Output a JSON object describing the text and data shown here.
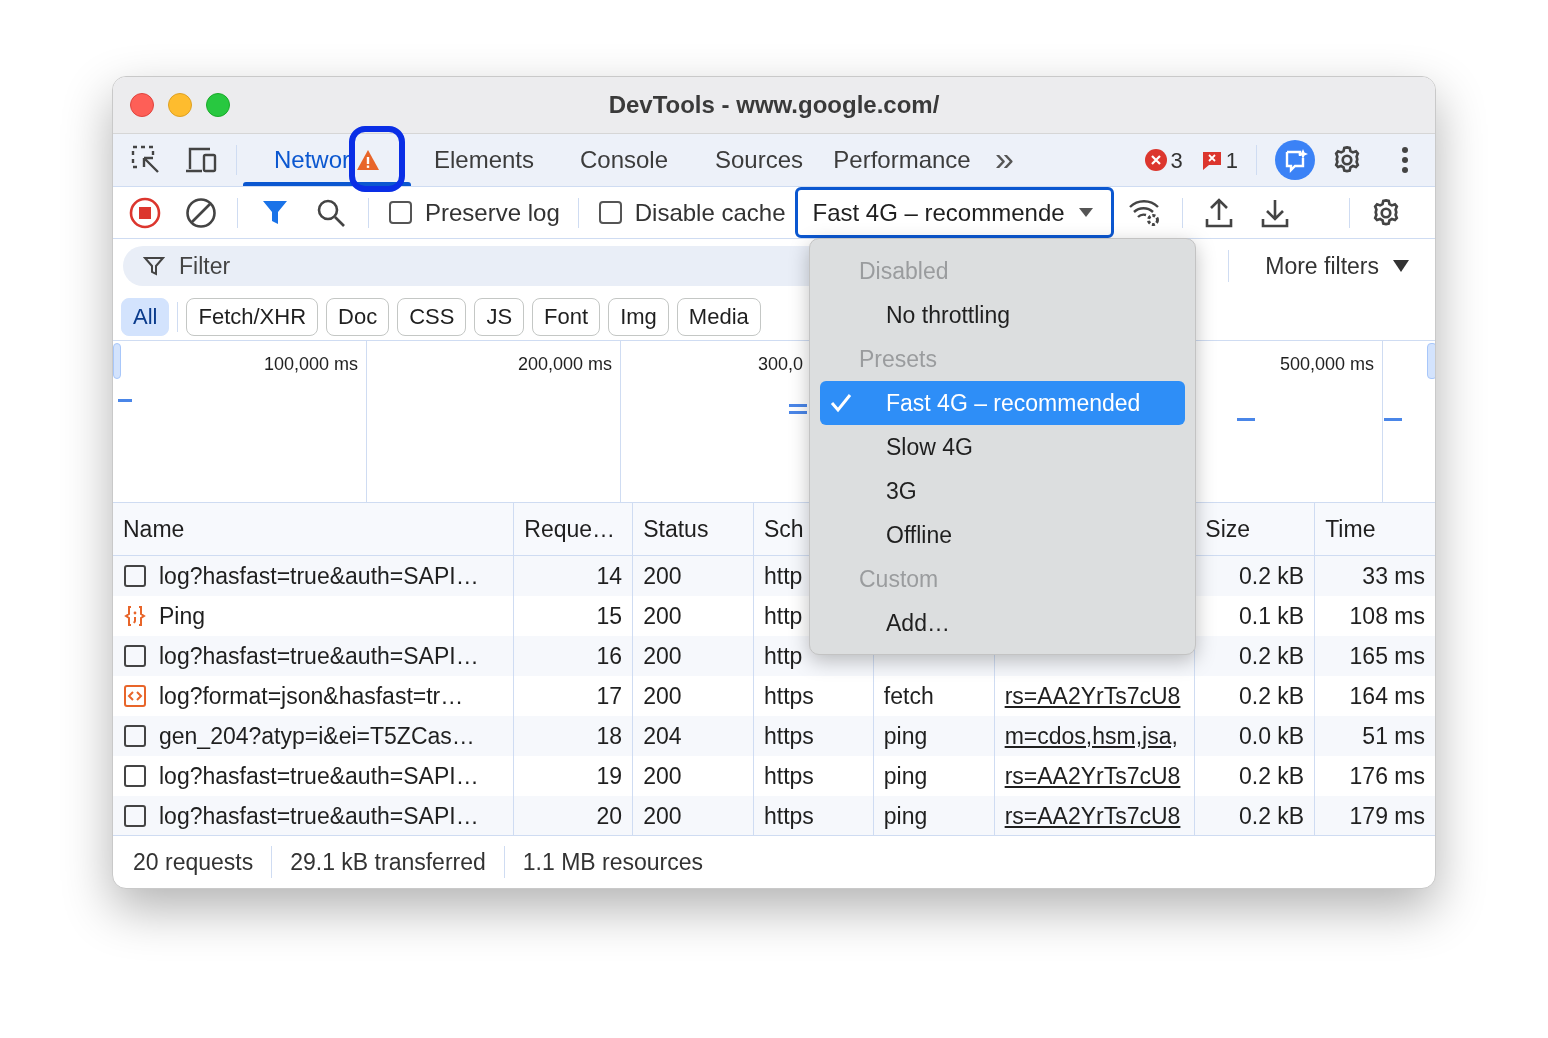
{
  "window": {
    "title": "DevTools - www.google.com/"
  },
  "tabs": [
    {
      "label": "Networ",
      "selected": true,
      "warning": true
    },
    {
      "label": "Elements",
      "selected": false
    },
    {
      "label": "Console",
      "selected": false
    },
    {
      "label": "Sources",
      "selected": false
    },
    {
      "label": "Performance",
      "selected": false
    }
  ],
  "overflow_glyph": "»",
  "counters": {
    "errors": "3",
    "issues": "1"
  },
  "toolbar": {
    "preserve_log": {
      "label": "Preserve log",
      "checked": false
    },
    "disable_cache": {
      "label": "Disable cache",
      "checked": false
    },
    "throttling": {
      "value": "Fast 4G – recommende",
      "expanded": true
    }
  },
  "filter": {
    "placeholder": "Filter",
    "more_filters": "More filters"
  },
  "type_filters": [
    {
      "label": "All",
      "selected": true
    },
    {
      "label": "Fetch/XHR",
      "selected": false
    },
    {
      "label": "Doc",
      "selected": false
    },
    {
      "label": "CSS",
      "selected": false
    },
    {
      "label": "JS",
      "selected": false
    },
    {
      "label": "Font",
      "selected": false
    },
    {
      "label": "Img",
      "selected": false
    },
    {
      "label": "Media",
      "selected": false
    }
  ],
  "timeline": {
    "labels": [
      "100,000 ms",
      "200,000 ms",
      "300,0",
      "500,000 ms"
    ]
  },
  "table": {
    "columns": [
      "Name",
      "Reque…",
      "Status",
      "Sch",
      null,
      null,
      "Size",
      "Time"
    ],
    "rows": [
      {
        "kind": "other",
        "cells": [
          "log?hasfast=true&auth=SAPI…",
          "14",
          "200",
          "http",
          null,
          null,
          "0.2 kB",
          "33 ms"
        ]
      },
      {
        "kind": "script",
        "cells": [
          "Ping",
          "15",
          "200",
          "http",
          null,
          null,
          "0.1 kB",
          "108 ms"
        ]
      },
      {
        "kind": "other",
        "cells": [
          "log?hasfast=true&auth=SAPI…",
          "16",
          "200",
          "http",
          null,
          null,
          "0.2 kB",
          "165 ms"
        ]
      },
      {
        "kind": "fetch",
        "cells": [
          "log?format=json&hasfast=tr…",
          "17",
          "200",
          "https",
          "fetch",
          "rs=AA2YrTs7cU8",
          "0.2 kB",
          "164 ms"
        ]
      },
      {
        "kind": "other",
        "cells": [
          "gen_204?atyp=i&ei=T5ZCas…",
          "18",
          "204",
          "https",
          "ping",
          "m=cdos,hsm,jsa,",
          "0.0 kB",
          "51 ms"
        ]
      },
      {
        "kind": "other",
        "cells": [
          "log?hasfast=true&auth=SAPI…",
          "19",
          "200",
          "https",
          "ping",
          "rs=AA2YrTs7cU8",
          "0.2 kB",
          "176 ms"
        ]
      },
      {
        "kind": "other",
        "cells": [
          "log?hasfast=true&auth=SAPI…",
          "20",
          "200",
          "https",
          "ping",
          "rs=AA2YrTs7cU8",
          "0.2 kB",
          "179 ms"
        ]
      }
    ]
  },
  "throttle_menu": [
    {
      "kind": "header",
      "label": "Disabled"
    },
    {
      "kind": "option",
      "label": "No throttling",
      "selected": false
    },
    {
      "kind": "header",
      "label": "Presets"
    },
    {
      "kind": "option",
      "label": "Fast 4G – recommended",
      "selected": true
    },
    {
      "kind": "option",
      "label": "Slow 4G",
      "selected": false
    },
    {
      "kind": "option",
      "label": "3G",
      "selected": false
    },
    {
      "kind": "option",
      "label": "Offline",
      "selected": false
    },
    {
      "kind": "header",
      "label": "Custom"
    },
    {
      "kind": "option",
      "label": "Add…",
      "selected": false
    }
  ],
  "status_bar": [
    "20 requests",
    "29.1 kB transferred",
    "1.1 MB resources"
  ]
}
